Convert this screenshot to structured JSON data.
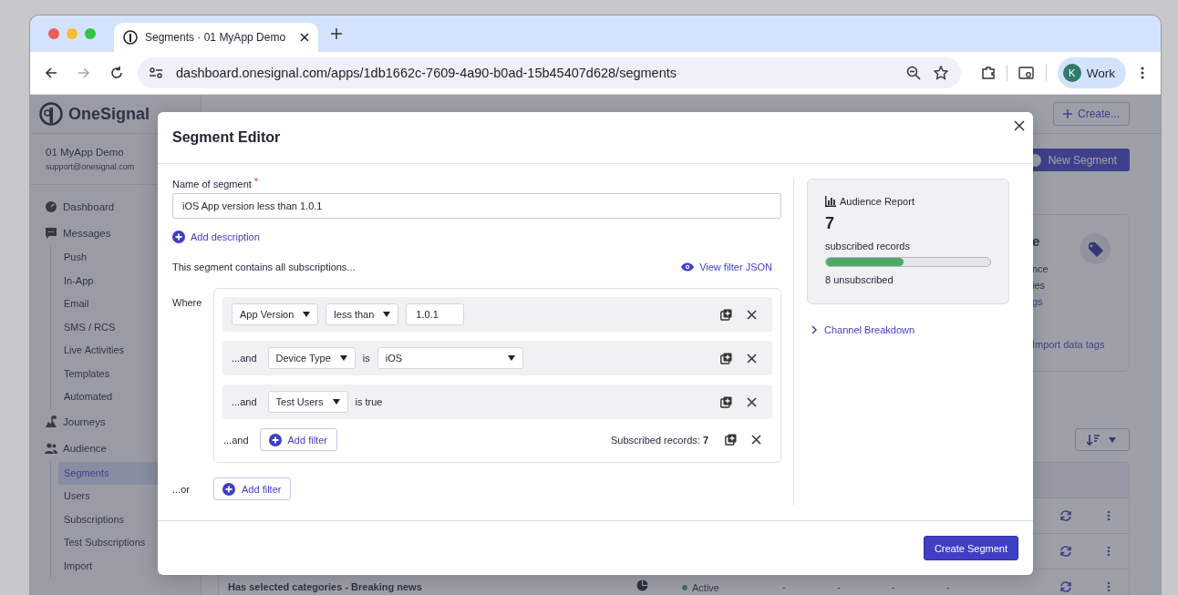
{
  "browser": {
    "tab_title": "Segments · 01 MyApp Demo",
    "url": "dashboard.onesignal.com/apps/1db1662c-7609-4a90-b0ad-15b45407d628/segments",
    "profile": {
      "initial": "K",
      "label": "Work"
    }
  },
  "sidebar": {
    "brand": "OneSignal",
    "app_name": "01 MyApp Demo",
    "email": "support@onesignal.com",
    "items": [
      {
        "label": "Dashboard",
        "kind": "dashboard",
        "selected": false
      },
      {
        "label": "Messages",
        "kind": "messages",
        "selected": false,
        "children": [
          {
            "label": "Push",
            "selected": false
          },
          {
            "label": "In-App",
            "selected": false
          },
          {
            "label": "Email",
            "selected": false
          },
          {
            "label": "SMS / RCS",
            "selected": false
          },
          {
            "label": "Live Activities",
            "selected": false
          },
          {
            "label": "Templates",
            "selected": false
          },
          {
            "label": "Automated",
            "selected": false
          }
        ]
      },
      {
        "label": "Journeys",
        "kind": "journeys",
        "selected": false
      },
      {
        "label": "Audience",
        "kind": "audience",
        "selected": false,
        "children": [
          {
            "label": "Segments",
            "selected": true
          },
          {
            "label": "Users",
            "selected": false
          },
          {
            "label": "Subscriptions",
            "selected": false
          },
          {
            "label": "Test Subscriptions",
            "selected": false
          },
          {
            "label": "Import",
            "selected": false
          }
        ]
      }
    ]
  },
  "top_bar": {
    "create_button": "Create..."
  },
  "new_segment_button": "New Segment",
  "tags_card": {
    "fragments": [
      {
        "text": "e",
        "kind": "heading"
      },
      {
        "text": "nce",
        "kind": "text"
      },
      {
        "text": "ies",
        "kind": "text"
      },
      {
        "text": "gs",
        "kind": "link"
      }
    ],
    "link": "Import data tags"
  },
  "table": {
    "rows": [
      {
        "cells": []
      },
      {
        "cells": []
      },
      {
        "name": "Has selected categories - Breaking news",
        "status": "Active",
        "cells": [
          "-",
          "-",
          "-",
          "-"
        ]
      }
    ]
  },
  "modal": {
    "title": "Segment Editor",
    "name_label": "Name of segment",
    "required_mark": "*",
    "name_value": "iOS App version less than 1.0.1",
    "add_description": "Add description",
    "summary": "This segment contains all subscriptions...",
    "view_json": "View filter JSON",
    "where_label": "Where",
    "filters": [
      {
        "parts": [
          {
            "kind": "select",
            "value": "App Version"
          },
          {
            "kind": "select",
            "value": "less than"
          },
          {
            "kind": "input",
            "value": "1.0.1"
          }
        ]
      },
      {
        "prefix": "...and",
        "parts": [
          {
            "kind": "select",
            "value": "Device Type"
          },
          {
            "kind": "text",
            "value": "is"
          },
          {
            "kind": "wide-select",
            "value": "iOS"
          }
        ]
      },
      {
        "prefix": "...and",
        "parts": [
          {
            "kind": "select",
            "value": "Test Users"
          },
          {
            "kind": "text",
            "value": "is true"
          }
        ]
      }
    ],
    "and_label": "...and",
    "add_filter": "Add filter",
    "subscribed_records": "Subscribed records: **7**",
    "or_label": "...or",
    "or_add_filter": "Add filter",
    "report": {
      "title": "Audience Report",
      "count": "7",
      "label": "subscribed records",
      "level": 0.47,
      "unsubscribed": "8 unsubscribed"
    },
    "channel_breakdown": {
      "label": "Channel Breakdown",
      "expanded": false
    },
    "create_button": "Create Segment"
  }
}
